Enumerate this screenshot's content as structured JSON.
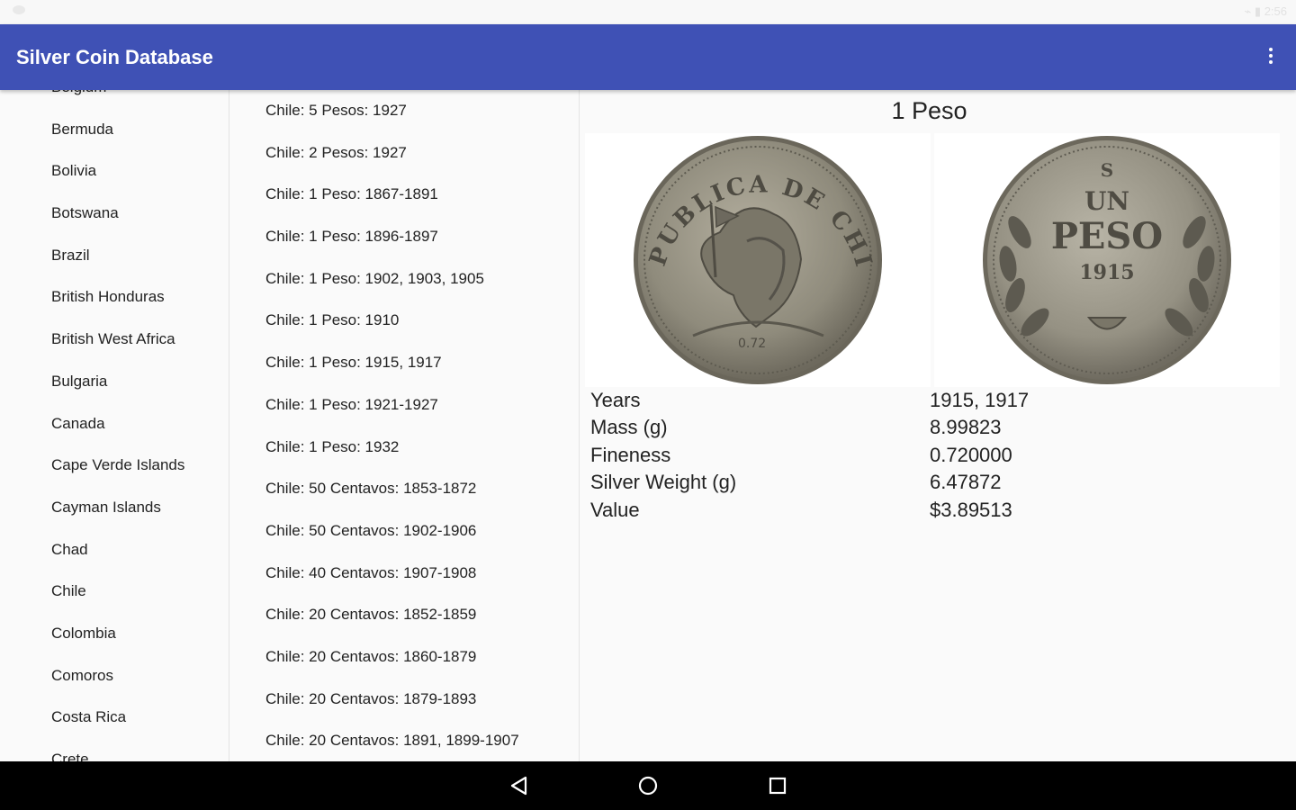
{
  "app": {
    "title": "Silver Coin Database"
  },
  "status_bar": {
    "right_text": "⌁ ▮ 2:56"
  },
  "countries": [
    "Belgium",
    "Bermuda",
    "Bolivia",
    "Botswana",
    "Brazil",
    "British Honduras",
    "British West Africa",
    "Bulgaria",
    "Canada",
    "Cape Verde Islands",
    "Cayman Islands",
    "Chad",
    "Chile",
    "Colombia",
    "Comoros",
    "Costa Rica",
    "Crete"
  ],
  "coins": [
    "Chile: 5 Pesos: 1927",
    "Chile: 2 Pesos: 1927",
    "Chile: 1 Peso: 1867-1891",
    "Chile: 1 Peso: 1896-1897",
    "Chile: 1 Peso: 1902, 1903, 1905",
    "Chile: 1 Peso: 1910",
    "Chile: 1 Peso: 1915, 1917",
    "Chile: 1 Peso: 1921-1927",
    "Chile: 1 Peso: 1932",
    "Chile: 50 Centavos: 1853-1872",
    "Chile: 50 Centavos: 1902-1906",
    "Chile: 40 Centavos: 1907-1908",
    "Chile: 20 Centavos: 1852-1859",
    "Chile: 20 Centavos: 1860-1879",
    "Chile: 20 Centavos: 1879-1893",
    "Chile: 20 Centavos: 1891, 1899-1907"
  ],
  "detail": {
    "title": "1 Peso",
    "obverse": {
      "legend": "REPUBLICA DE CHILE",
      "mark": "0.72"
    },
    "reverse": {
      "mint": "S",
      "line1": "UN",
      "line2": "PESO",
      "year": "1915"
    },
    "properties": [
      {
        "label": "Years",
        "value": "1915, 1917"
      },
      {
        "label": "Mass (g)",
        "value": "8.99823"
      },
      {
        "label": "Fineness",
        "value": "0.720000"
      },
      {
        "label": "Silver Weight (g)",
        "value": "6.47872"
      },
      {
        "label": "Value",
        "value": "$3.89513"
      }
    ]
  },
  "colors": {
    "appbar": "#3f51b5",
    "background": "#fafafa",
    "coin": "#9a9688"
  }
}
